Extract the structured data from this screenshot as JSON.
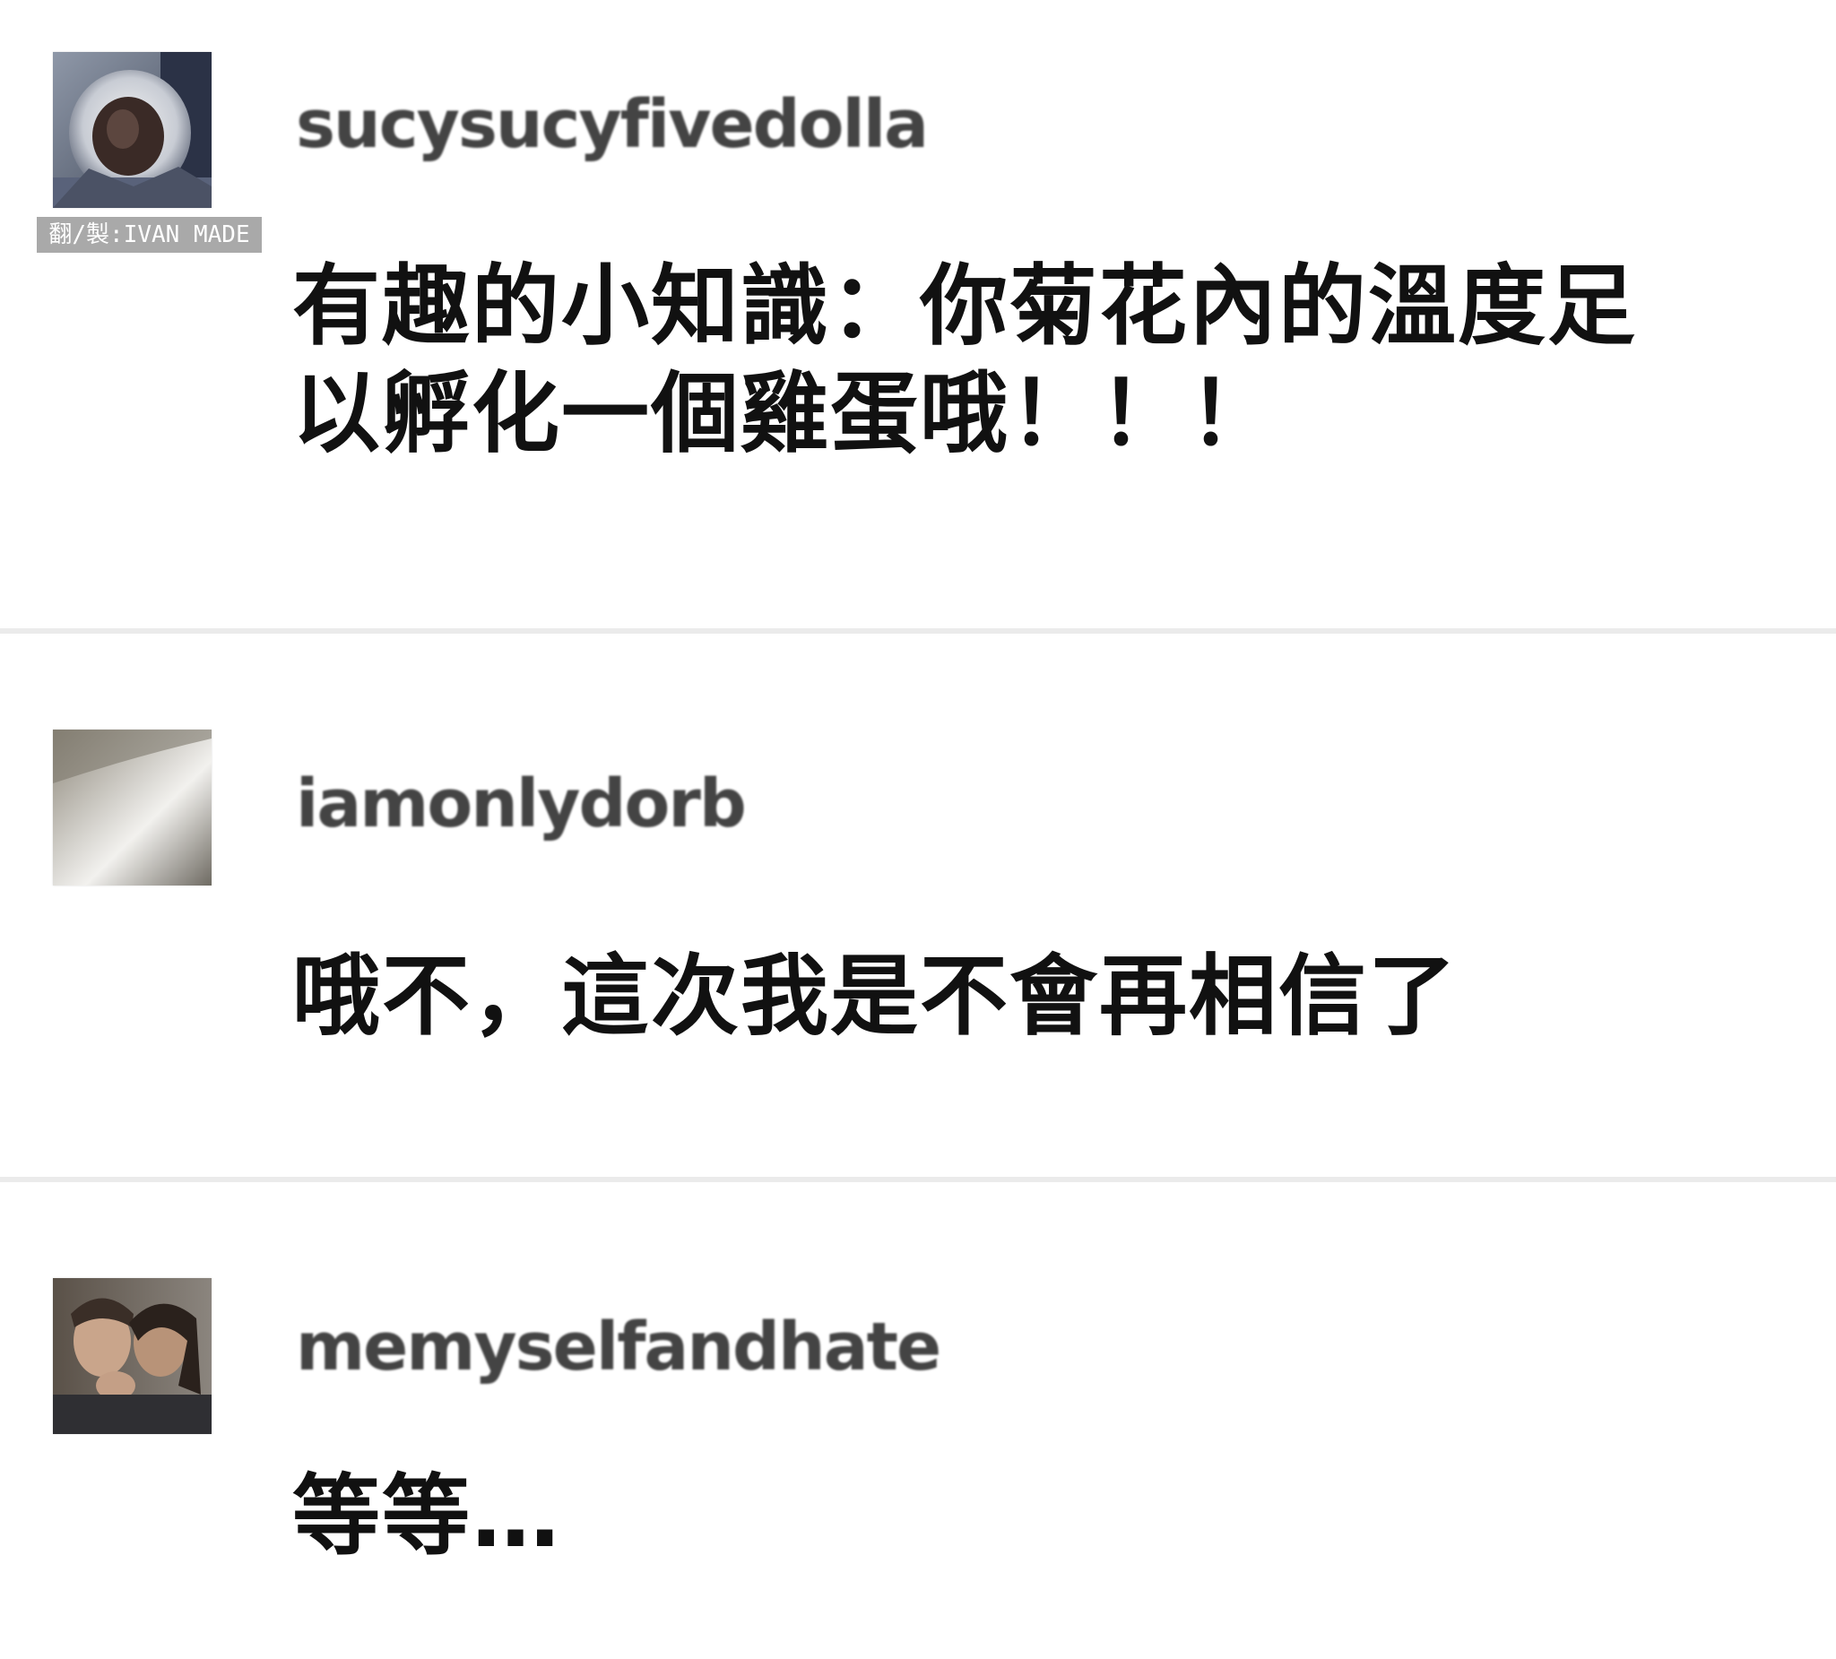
{
  "watermark": "翻/製:IVAN MADE",
  "posts": [
    {
      "username": "sucysucyfivedolla",
      "comment": "有趣的小知識：你菊花內的溫度足以孵化一個雞蛋哦！！！",
      "avatar_icon": "astronaut-helmet-avatar"
    },
    {
      "username": "iamonlydorb",
      "comment": "哦不，這次我是不會再相信了",
      "avatar_icon": "gray-blur-avatar"
    },
    {
      "username": "memyselfandhate",
      "comment": "等等…",
      "avatar_icon": "couple-photo-avatar"
    }
  ],
  "colors": {
    "background": "#ffffff",
    "divider": "#ebebeb",
    "username": "#444444",
    "comment": "#111111",
    "watermark_bg": "#a9a9a9"
  }
}
